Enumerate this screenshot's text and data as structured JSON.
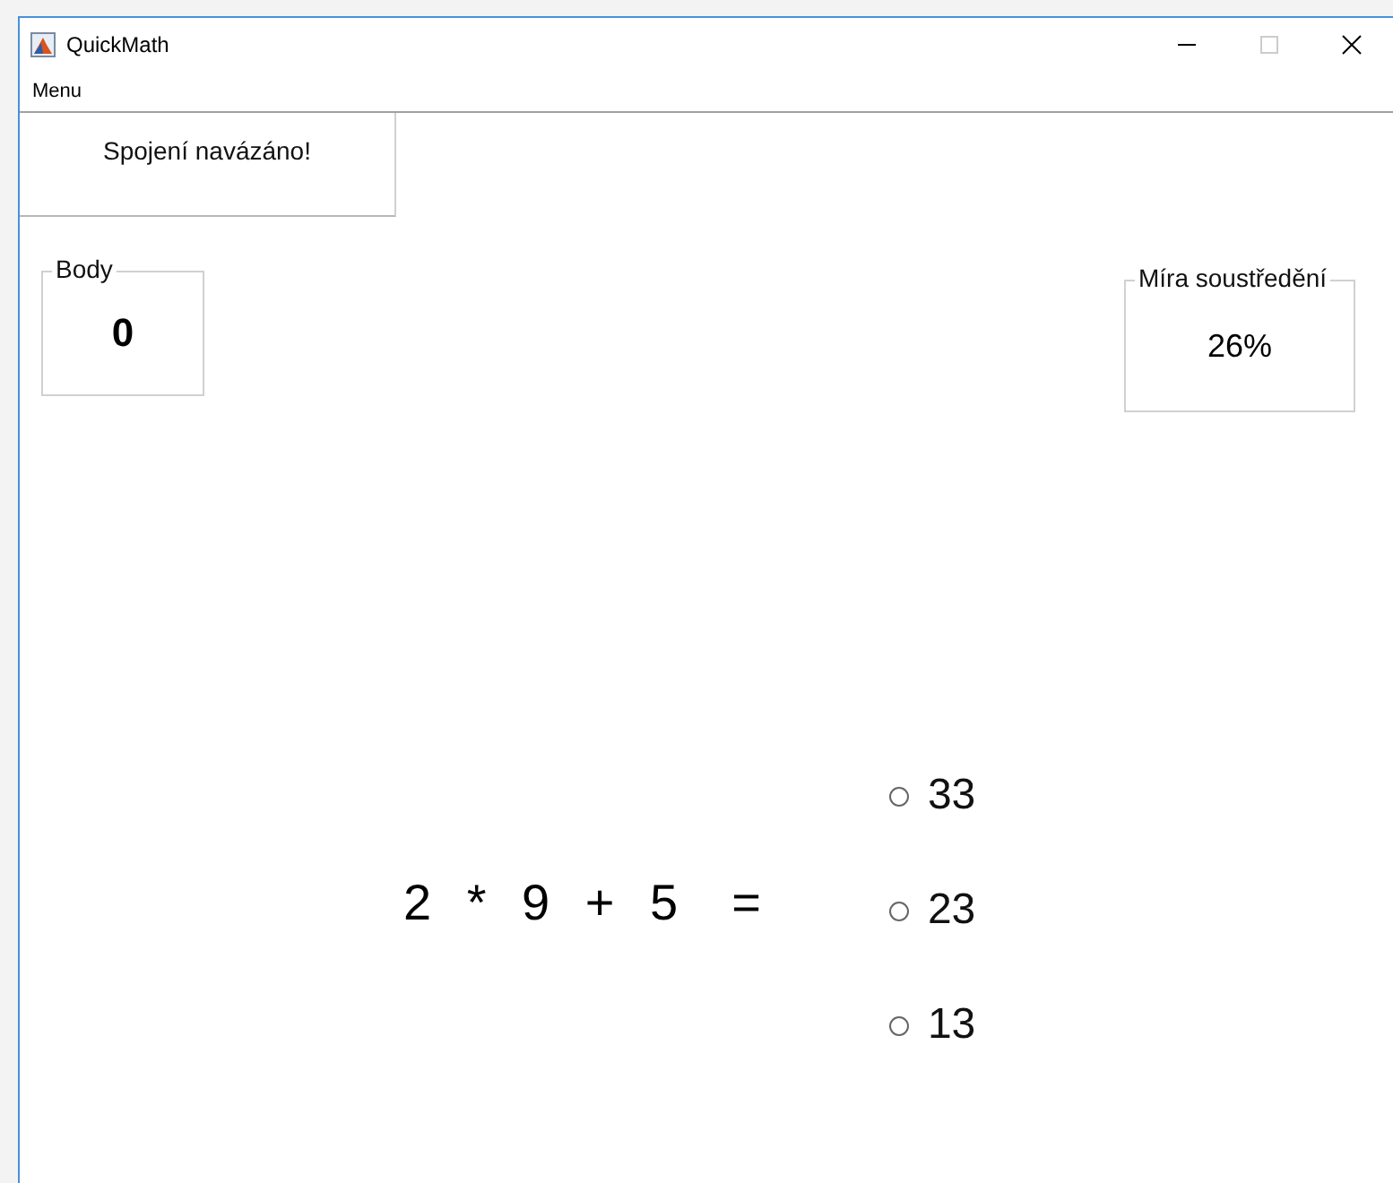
{
  "window": {
    "title": "QuickMath"
  },
  "menu": [
    "Menu"
  ],
  "status": "Spojení navázáno!",
  "score": {
    "label": "Body",
    "value": "0"
  },
  "focus": {
    "label": "Míra soustředění",
    "value": "26%"
  },
  "question": {
    "expression": "2 * 9 + 5",
    "equals": "="
  },
  "answers": [
    {
      "label": "33",
      "selected": false
    },
    {
      "label": "23",
      "selected": false
    },
    {
      "label": "13",
      "selected": false
    }
  ]
}
